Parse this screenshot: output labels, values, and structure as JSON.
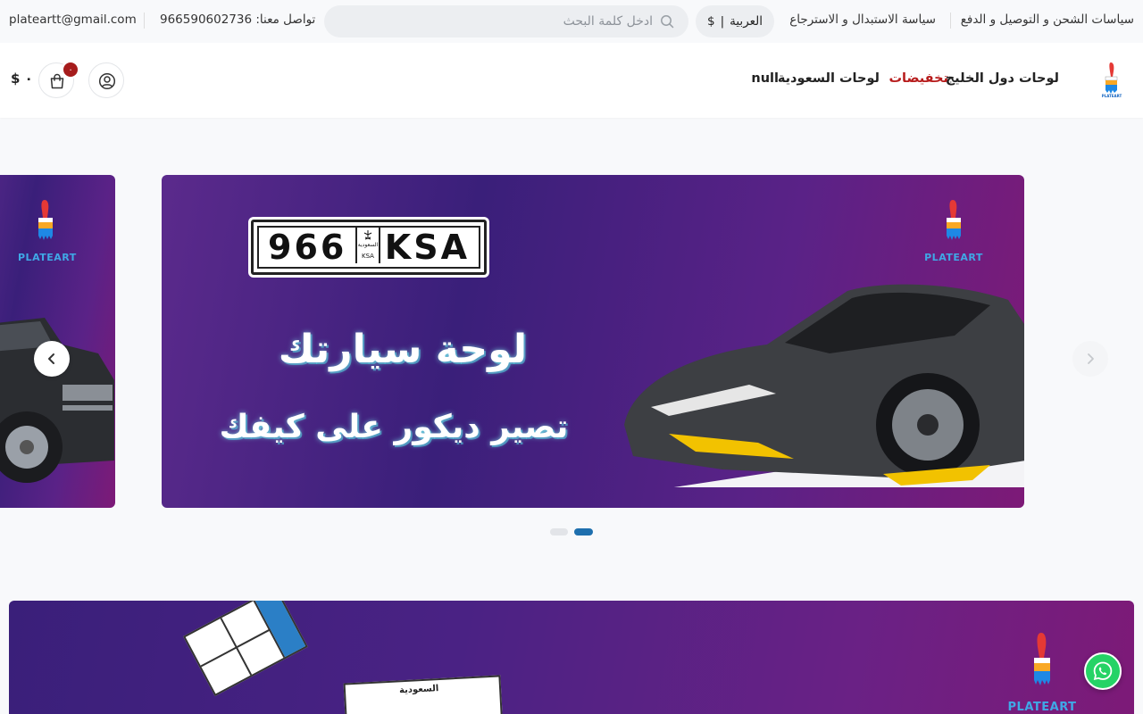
{
  "topbar": {
    "shipping_policy": "سياسات الشحن و التوصيل و الدفع",
    "return_policy": "سياسة الاستبدال و الاسترجاع",
    "language": "العربية",
    "currency": "$",
    "search_placeholder": "ادخل كلمة البحث",
    "contact": "تواصل معنا: 966590602736",
    "email": "plateartt@gmail.com"
  },
  "header": {
    "nav": [
      {
        "label": "لوحات دول الخليج"
      },
      {
        "label": "تخفيضات"
      },
      {
        "label": "لوحات السعودية"
      },
      {
        "label": "null"
      }
    ],
    "cart_count": "٠",
    "cart_total": "$ ٠"
  },
  "slider": {
    "main": {
      "plate_number": "966",
      "plate_letters": "KSA",
      "plate_country": "السعودية",
      "plate_code": "KSA",
      "headline": "لوحة سيارتك",
      "subline": "تصير ديكور على كيفك",
      "brand": "PLATEART"
    },
    "prev": {
      "brand": "PLATEART"
    },
    "active_index": 1,
    "total": 2
  },
  "banner2": {
    "brand": "PLATEART",
    "plate_label": "السعودية"
  },
  "colors": {
    "accent_red": "#b71c1c",
    "dot_active": "#1e6fae",
    "whatsapp": "#25d366"
  }
}
